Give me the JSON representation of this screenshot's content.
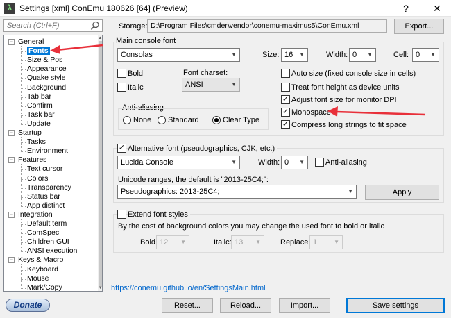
{
  "window": {
    "title": "Settings [xml] ConEmu 180626 [64] (Preview)",
    "help": "?",
    "close": "✕",
    "app_icon_glyph": "λ"
  },
  "sidebar": {
    "search_placeholder": "Search (Ctrl+F)",
    "tree": [
      {
        "label": "General",
        "level": 0
      },
      {
        "label": "Fonts",
        "level": 1,
        "selected": true
      },
      {
        "label": "Size & Pos",
        "level": 1
      },
      {
        "label": "Appearance",
        "level": 1
      },
      {
        "label": "Quake style",
        "level": 1
      },
      {
        "label": "Background",
        "level": 1
      },
      {
        "label": "Tab bar",
        "level": 1
      },
      {
        "label": "Confirm",
        "level": 1
      },
      {
        "label": "Task bar",
        "level": 1
      },
      {
        "label": "Update",
        "level": 1
      },
      {
        "label": "Startup",
        "level": 0
      },
      {
        "label": "Tasks",
        "level": 1
      },
      {
        "label": "Environment",
        "level": 1
      },
      {
        "label": "Features",
        "level": 0
      },
      {
        "label": "Text cursor",
        "level": 1
      },
      {
        "label": "Colors",
        "level": 1
      },
      {
        "label": "Transparency",
        "level": 1
      },
      {
        "label": "Status bar",
        "level": 1
      },
      {
        "label": "App distinct",
        "level": 1
      },
      {
        "label": "Integration",
        "level": 0
      },
      {
        "label": "Default term",
        "level": 1
      },
      {
        "label": "ComSpec",
        "level": 1
      },
      {
        "label": "Children GUI",
        "level": 1
      },
      {
        "label": "ANSI execution",
        "level": 1
      },
      {
        "label": "Keys & Macro",
        "level": 0
      },
      {
        "label": "Keyboard",
        "level": 1
      },
      {
        "label": "Mouse",
        "level": 1
      },
      {
        "label": "Mark/Copy",
        "level": 1
      }
    ],
    "donate": "Donate"
  },
  "storage": {
    "label": "Storage:",
    "path": "D:\\Program Files\\cmder\\vendor\\conemu-maximus5\\ConEmu.xml",
    "export": "Export..."
  },
  "main_font": {
    "group_title": "Main console font",
    "font": "Consolas",
    "size_label": "Size:",
    "size": "16",
    "width_label": "Width:",
    "width": "0",
    "cell_label": "Cell:",
    "cell": "0",
    "bold": "Bold",
    "italic": "Italic",
    "charset_label": "Font charset:",
    "charset": "ANSI",
    "aa_title": "Anti-aliasing",
    "aa_none": "None",
    "aa_standard": "Standard",
    "aa_cleartype": "Clear Type",
    "auto_size": "Auto size (fixed console size in cells)",
    "treat_height": "Treat font height as device units",
    "adjust_dpi": "Adjust font size for monitor DPI",
    "monospace": "Monospace",
    "compress": "Compress long strings to fit space"
  },
  "alt_font": {
    "checkbox": "Alternative font (pseudographics, CJK, etc.)",
    "font": "Lucida Console",
    "width_label": "Width:",
    "width": "0",
    "anti_aliasing": "Anti-aliasing",
    "ranges_label": "Unicode ranges, the default is \"2013-25C4;\":",
    "ranges": "Pseudographics: 2013-25C4;",
    "apply": "Apply"
  },
  "extend": {
    "checkbox": "Extend font styles",
    "description": "By the cost of background colors you may change the used font to bold or italic",
    "bold_label": "Bold:",
    "bold": "12",
    "italic_label": "Italic:",
    "italic": "13",
    "replace_label": "Replace:",
    "replace": "1"
  },
  "footer": {
    "link": "https://conemu.github.io/en/SettingsMain.html",
    "reset": "Reset...",
    "reload": "Reload...",
    "import": "Import...",
    "save": "Save settings"
  },
  "colors": {
    "accent": "#0078d7",
    "annotation_arrow": "#e8303a",
    "link": "#0066cc"
  }
}
